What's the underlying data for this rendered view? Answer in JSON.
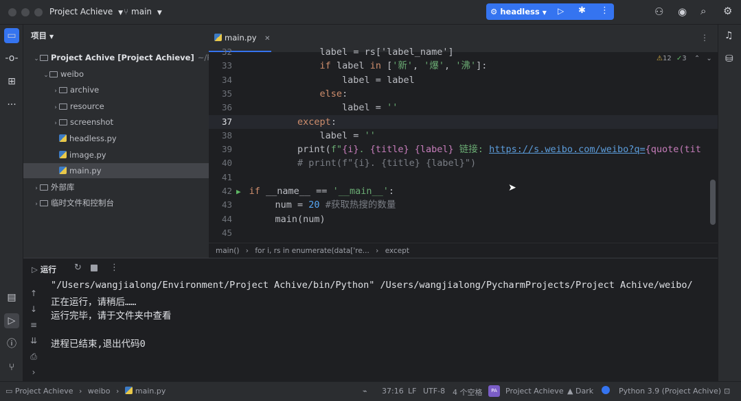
{
  "titlebar": {
    "project": "Project Achieve",
    "branch": "main",
    "run_config": "headless"
  },
  "project_panel": {
    "title": "项目",
    "items": [
      {
        "label": "Project Achive [Project Achieve]",
        "suffix": "~/Pycharm",
        "depth": 0,
        "type": "folder",
        "expanded": true
      },
      {
        "label": "weibo",
        "depth": 1,
        "type": "folder",
        "expanded": true
      },
      {
        "label": "archive",
        "depth": 2,
        "type": "folder",
        "expanded": false
      },
      {
        "label": "resource",
        "depth": 2,
        "type": "folder",
        "expanded": false
      },
      {
        "label": "screenshot",
        "depth": 2,
        "type": "folder",
        "expanded": false
      },
      {
        "label": "headless.py",
        "depth": 2,
        "type": "python"
      },
      {
        "label": "image.py",
        "depth": 2,
        "type": "python"
      },
      {
        "label": "main.py",
        "depth": 2,
        "type": "python",
        "selected": true
      },
      {
        "label": "外部库",
        "depth": 0,
        "type": "library"
      },
      {
        "label": "临时文件和控制台",
        "depth": 0,
        "type": "scratch"
      }
    ]
  },
  "editor": {
    "tab": "main.py",
    "warnings": "12",
    "checks": "3",
    "lines": [
      {
        "n": "32",
        "html": "            <span>label = rs['label_name']</span>"
      },
      {
        "n": "33",
        "html": "            <span class=\"kw\">if</span> label <span class=\"kw\">in</span> [<span class=\"str\">'新'</span>, <span class=\"str\">'爆'</span>, <span class=\"str\">'沸'</span>]:"
      },
      {
        "n": "34",
        "html": "                label = label"
      },
      {
        "n": "35",
        "html": "            <span class=\"kw\">else</span>:"
      },
      {
        "n": "36",
        "html": "                label = <span class=\"str\">''</span>"
      },
      {
        "n": "37",
        "html": "        <span class=\"kw\">except</span>:"
      },
      {
        "n": "38",
        "html": "            label = <span class=\"str\">''</span>"
      },
      {
        "n": "39",
        "html": "        print(<span class=\"str\">f\"</span><span class=\"brace\">{i}</span><span class=\"str\">. </span><span class=\"brace\">{title}</span><span class=\"str\"> </span><span class=\"brace\">{label}</span><span class=\"str\"> 链接: </span><span class=\"url\">https://s.weibo.com/weibo?q=</span><span class=\"brace\">{quote(tit</span>"
      },
      {
        "n": "40",
        "html": "        <span class=\"cm\"># print(f\"{i}. {title} {label}\")</span>"
      },
      {
        "n": "41",
        "html": ""
      },
      {
        "n": "42",
        "html": "<span class=\"kw\">if</span> __name__ == <span class=\"str\">'__main__'</span>:"
      },
      {
        "n": "43",
        "html": "    num = <span class=\"fn\">20</span> <span class=\"cm\">#获取热搜的数量</span>"
      },
      {
        "n": "44",
        "html": "    main(num)"
      },
      {
        "n": "45",
        "html": ""
      }
    ],
    "breadcrumbs": [
      "main()",
      "for i, rs in enumerate(data['re...",
      "except"
    ]
  },
  "run_panel": {
    "title": "运行",
    "output": [
      "\"/Users/wangjialong/Environment/Project Achive/bin/Python\" /Users/wangjialong/PycharmProjects/Project Achive/weibo/",
      "正在运行，请稍后……",
      "运行完毕，请于文件夹中查看",
      "",
      "进程已结束,退出代码0"
    ]
  },
  "statusbar": {
    "crumbs": [
      "Project Achieve",
      "weibo",
      "main.py"
    ],
    "position": "37:16",
    "line_sep": "LF",
    "encoding": "UTF-8",
    "indent": "4 个空格",
    "project": "Project Achieve",
    "project_badge": "PA",
    "theme": "Dark",
    "interpreter": "Python 3.9 (Project Achive)"
  }
}
